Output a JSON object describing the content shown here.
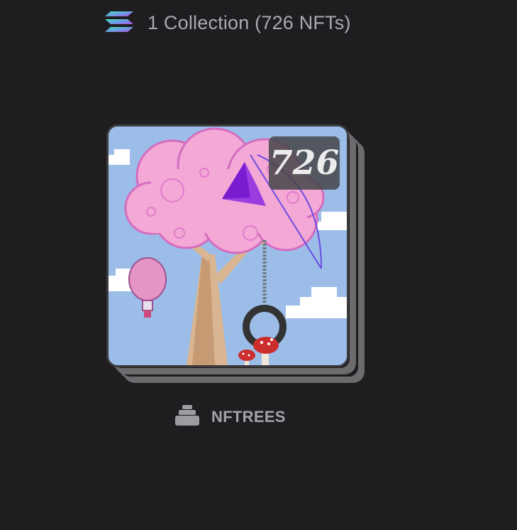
{
  "header": {
    "icon": "solana-logo-icon",
    "title": "1 Collection (726 NFTs)"
  },
  "collection": {
    "name": "NFTREES",
    "count_badge": "726",
    "icon": "stack-icon",
    "cover_image": "pink-tree-with-swing-pixel-art"
  },
  "colors": {
    "background": "#1f1d20",
    "text": "#a9a9ae",
    "stack_layer": "#6c6b6e"
  }
}
